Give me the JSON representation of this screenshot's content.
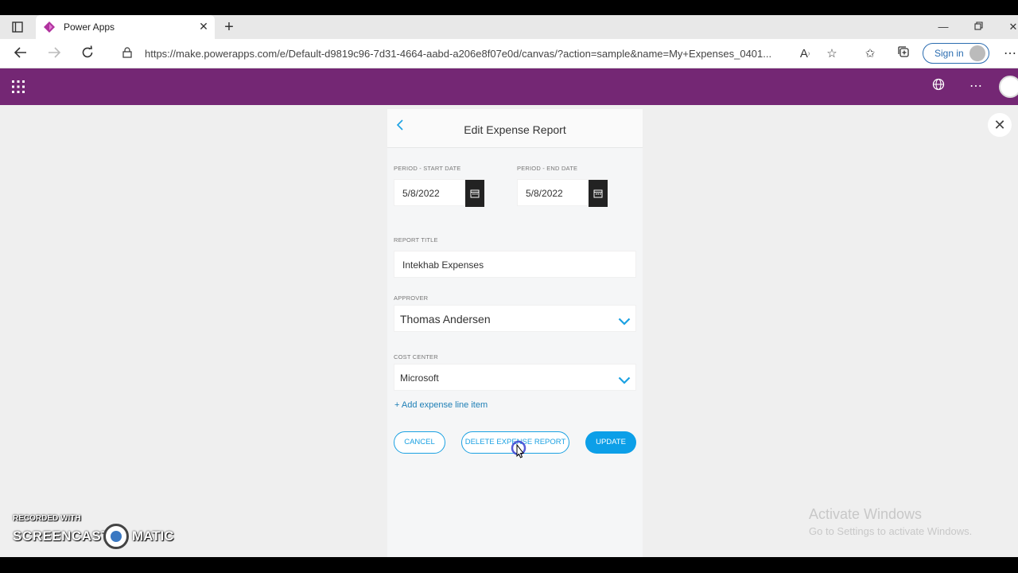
{
  "browser": {
    "tab_title": "Power Apps",
    "url": "https://make.powerapps.com/e/Default-d9819c96-7d31-4664-aabd-a206e8f07e0d/canvas/?action=sample&name=My+Expenses_0401...",
    "sign_in_label": "Sign in",
    "icons": [
      "tab-actions-icon",
      "power-apps-favicon",
      "close-icon",
      "plus-icon",
      "minimize-icon",
      "restore-icon",
      "back-arrow-icon",
      "forward-arrow-icon",
      "refresh-icon",
      "lock-icon",
      "read-aloud-icon",
      "favorite-add-icon",
      "favorites-icon",
      "collections-icon",
      "profile-icon",
      "more-icon"
    ]
  },
  "appbar": {
    "color": "#742774",
    "icons": [
      "waffle-icon",
      "globe-icon",
      "ellipsis-icon",
      "avatar"
    ]
  },
  "form": {
    "title": "Edit Expense Report",
    "start_date_label": "PERIOD - START DATE",
    "start_date": "5/8/2022",
    "end_date_label": "PERIOD - END DATE",
    "end_date": "5/8/2022",
    "report_title_label": "REPORT TITLE",
    "report_title": "Intekhab Expenses",
    "approver_label": "APPROVER",
    "approver": "Thomas Andersen",
    "cost_center_label": "COST CENTER",
    "cost_center": "Microsoft",
    "add_line_label": "+ Add expense line item",
    "cancel_label": "CANCEL",
    "delete_label": "DELETE EXPENSE REPORT",
    "update_label": "UPDATE",
    "accent": "#0c9fe8"
  },
  "overlay": {
    "recorded_with": "RECORDED WITH",
    "screencast": "SCREENCAST",
    "matic": "MATIC",
    "activate_title": "Activate Windows",
    "activate_sub": "Go to Settings to activate Windows."
  }
}
